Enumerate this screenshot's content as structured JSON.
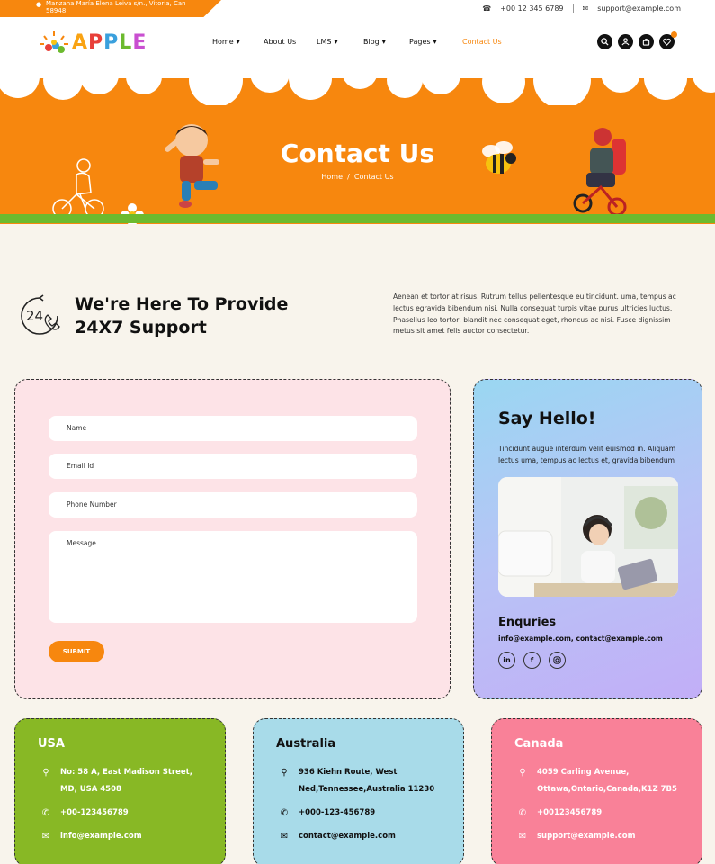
{
  "topbar": {
    "address": "Manzana María Elena Leiva s/n., Vitoria, Can 58948",
    "phone": "+00 12 345 6789",
    "email": "support@example.com"
  },
  "header": {
    "logo": "APPLE",
    "nav": [
      {
        "label": "Home",
        "has_dropdown": true
      },
      {
        "label": "About Us",
        "has_dropdown": false
      },
      {
        "label": "LMS",
        "has_dropdown": true
      },
      {
        "label": "Blog",
        "has_dropdown": true
      },
      {
        "label": "Pages",
        "has_dropdown": true
      },
      {
        "label": "Contact Us",
        "has_dropdown": false,
        "active": true
      }
    ],
    "icons": [
      "search-icon",
      "user-icon",
      "cart-icon",
      "heart-icon"
    ]
  },
  "banner": {
    "title": "Contact Us",
    "breadcrumb_home": "Home",
    "breadcrumb_sep": "/",
    "breadcrumb_current": "Contact Us"
  },
  "support": {
    "icon_label": "24",
    "title_line1": "We're Here To Provide",
    "title_line2": "24X7 Support",
    "text": "Aenean et tortor at risus. Rutrum tellus pellentesque eu tincidunt. uma, tempus ac lectus egravida bibendum nisi. Nulla consequat turpis vitae purus ultricies luctus. Phasellus leo tortor, blandit nec consequat eget, rhoncus ac nisi. Fusce dignissim metus sit amet felis auctor consectetur."
  },
  "form": {
    "name_placeholder": "Name",
    "email_placeholder": "Email Id",
    "phone_placeholder": "Phone Number",
    "message_placeholder": "Message",
    "submit_label": "SUBMIT"
  },
  "hello": {
    "title": "Say Hello!",
    "text": "Tincidunt augue interdum velit euismod in. Aliquam lectus uma, tempus ac lectus et, gravida bibendum",
    "enquiries_title": "Enquries",
    "emails": "info@example.com,  contact@example.com",
    "socials": [
      "in",
      "f",
      "ig"
    ]
  },
  "countries": [
    {
      "name": "USA",
      "address": "No: 58 A, East Madison Street, MD, USA 4508",
      "phone": "+00-123456789",
      "email": "info@example.com"
    },
    {
      "name": "Australia",
      "address": "936 Kiehn Route, West Ned,Tennessee,Australia 11230",
      "phone": "+000-123-456789",
      "email": "contact@example.com"
    },
    {
      "name": "Canada",
      "address": "4059 Carling Avenue, Ottawa,Ontario,Canada,K1Z 7B5",
      "phone": "+00123456789",
      "email": "support@example.com"
    }
  ],
  "colors": {
    "accent": "#f7870e",
    "green": "#88b825",
    "blue": "#a8dbe9",
    "pink": "#f98198",
    "form_bg": "#fde3e7"
  }
}
